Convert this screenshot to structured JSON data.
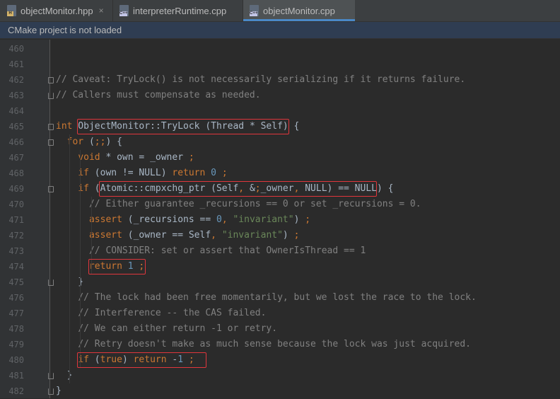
{
  "tabs": [
    {
      "label": "objectMonitor.hpp",
      "badge": "H",
      "close": "×"
    },
    {
      "label": "interpreterRuntime.cpp",
      "badge": "C++",
      "close": ""
    },
    {
      "label": "objectMonitor.cpp",
      "badge": "C++",
      "close": ""
    }
  ],
  "notice": "CMake project is not loaded",
  "lines": [
    {
      "num": "460",
      "text": ""
    },
    {
      "num": "461",
      "text": ""
    },
    {
      "num": "462",
      "text": "// Caveat: TryLock() is not necessarily serializing if it returns failure."
    },
    {
      "num": "463",
      "text": "// Callers must compensate as needed."
    },
    {
      "num": "464",
      "text": ""
    },
    {
      "num": "465",
      "text": "int ObjectMonitor::TryLock (Thread * Self) {"
    },
    {
      "num": "466",
      "text": "  for (;;) {"
    },
    {
      "num": "467",
      "text": "    void * own = _owner ;"
    },
    {
      "num": "468",
      "text": "    if (own != NULL) return 0 ;"
    },
    {
      "num": "469",
      "text": "    if (Atomic::cmpxchg_ptr (Self, &_owner, NULL) == NULL) {"
    },
    {
      "num": "470",
      "text": "      // Either guarantee _recursions == 0 or set _recursions = 0."
    },
    {
      "num": "471",
      "text": "      assert (_recursions == 0, \"invariant\") ;"
    },
    {
      "num": "472",
      "text": "      assert (_owner == Self, \"invariant\") ;"
    },
    {
      "num": "473",
      "text": "      // CONSIDER: set or assert that OwnerIsThread == 1"
    },
    {
      "num": "474",
      "text": "      return 1 ;"
    },
    {
      "num": "475",
      "text": "    }"
    },
    {
      "num": "476",
      "text": "    // The lock had been free momentarily, but we lost the race to the lock."
    },
    {
      "num": "477",
      "text": "    // Interference -- the CAS failed."
    },
    {
      "num": "478",
      "text": "    // We can either return -1 or retry."
    },
    {
      "num": "479",
      "text": "    // Retry doesn't make as much sense because the lock was just acquired."
    },
    {
      "num": "480",
      "text": "    if (true) return -1 ;"
    },
    {
      "num": "481",
      "text": "  }"
    },
    {
      "num": "482",
      "text": "}"
    }
  ],
  "colors": {
    "background": "#2b2b2b",
    "gutter": "#313335",
    "keyword": "#cc7832",
    "comment": "#808080",
    "number": "#6897bb",
    "string": "#6a8759",
    "highlight_box": "#e0363c",
    "active_tab_underline": "#4a88c7"
  }
}
